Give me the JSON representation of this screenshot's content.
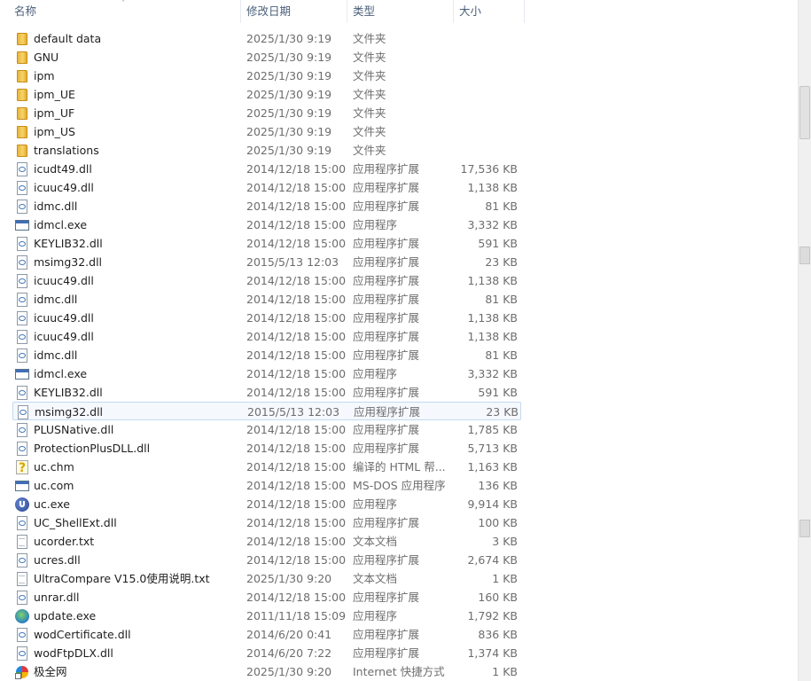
{
  "header": {
    "name": "名称",
    "date": "修改日期",
    "type": "类型",
    "size": "大小",
    "sort_arrow": "˄"
  },
  "files": [
    {
      "icon": "folder-icon",
      "name": "default data",
      "date": "2025/1/30 9:19",
      "type": "文件夹",
      "size": ""
    },
    {
      "icon": "folder-icon",
      "name": "GNU",
      "date": "2025/1/30 9:19",
      "type": "文件夹",
      "size": ""
    },
    {
      "icon": "folder-icon",
      "name": "ipm",
      "date": "2025/1/30 9:19",
      "type": "文件夹",
      "size": ""
    },
    {
      "icon": "folder-icon",
      "name": "ipm_UE",
      "date": "2025/1/30 9:19",
      "type": "文件夹",
      "size": ""
    },
    {
      "icon": "folder-icon",
      "name": "ipm_UF",
      "date": "2025/1/30 9:19",
      "type": "文件夹",
      "size": ""
    },
    {
      "icon": "folder-icon",
      "name": "ipm_US",
      "date": "2025/1/30 9:19",
      "type": "文件夹",
      "size": ""
    },
    {
      "icon": "folder-icon",
      "name": "translations",
      "date": "2025/1/30 9:19",
      "type": "文件夹",
      "size": ""
    },
    {
      "icon": "dll-file-icon",
      "name": "icudt49.dll",
      "date": "2014/12/18 15:00",
      "type": "应用程序扩展",
      "size": "17,536 KB"
    },
    {
      "icon": "dll-file-icon",
      "name": "icuuc49.dll",
      "date": "2014/12/18 15:00",
      "type": "应用程序扩展",
      "size": "1,138 KB"
    },
    {
      "icon": "dll-file-icon",
      "name": "idmc.dll",
      "date": "2014/12/18 15:00",
      "type": "应用程序扩展",
      "size": "81 KB"
    },
    {
      "icon": "exe-file-icon",
      "name": "idmcl.exe",
      "date": "2014/12/18 15:00",
      "type": "应用程序",
      "size": "3,332 KB"
    },
    {
      "icon": "dll-file-icon",
      "name": "KEYLIB32.dll",
      "date": "2014/12/18 15:00",
      "type": "应用程序扩展",
      "size": "591 KB"
    },
    {
      "icon": "dll-file-icon",
      "name": "msimg32.dll",
      "date": "2015/5/13 12:03",
      "type": "应用程序扩展",
      "size": "23 KB"
    },
    {
      "icon": "dll-file-icon",
      "name": "icuuc49.dll",
      "date": "2014/12/18 15:00",
      "type": "应用程序扩展",
      "size": "1,138 KB"
    },
    {
      "icon": "dll-file-icon",
      "name": "idmc.dll",
      "date": "2014/12/18 15:00",
      "type": "应用程序扩展",
      "size": "81 KB"
    },
    {
      "icon": "dll-file-icon",
      "name": "icuuc49.dll",
      "date": "2014/12/18 15:00",
      "type": "应用程序扩展",
      "size": "1,138 KB"
    },
    {
      "icon": "dll-file-icon",
      "name": "icuuc49.dll",
      "date": "2014/12/18 15:00",
      "type": "应用程序扩展",
      "size": "1,138 KB"
    },
    {
      "icon": "dll-file-icon",
      "name": "idmc.dll",
      "date": "2014/12/18 15:00",
      "type": "应用程序扩展",
      "size": "81 KB"
    },
    {
      "icon": "exe-file-icon",
      "name": "idmcl.exe",
      "date": "2014/12/18 15:00",
      "type": "应用程序",
      "size": "3,332 KB"
    },
    {
      "icon": "dll-file-icon",
      "name": "KEYLIB32.dll",
      "date": "2014/12/18 15:00",
      "type": "应用程序扩展",
      "size": "591 KB"
    },
    {
      "icon": "dll-file-icon",
      "name": "msimg32.dll",
      "date": "2015/5/13 12:03",
      "type": "应用程序扩展",
      "size": "23 KB",
      "selected": true
    },
    {
      "icon": "dll-file-icon",
      "name": "PLUSNative.dll",
      "date": "2014/12/18 15:00",
      "type": "应用程序扩展",
      "size": "1,785 KB"
    },
    {
      "icon": "dll-file-icon",
      "name": "ProtectionPlusDLL.dll",
      "date": "2014/12/18 15:00",
      "type": "应用程序扩展",
      "size": "5,713 KB"
    },
    {
      "icon": "help-file-icon",
      "name": "uc.chm",
      "date": "2014/12/18 15:00",
      "type": "编译的 HTML 帮...",
      "size": "1,163 KB"
    },
    {
      "icon": "exe-file-icon",
      "name": "uc.com",
      "date": "2014/12/18 15:00",
      "type": "MS-DOS 应用程序",
      "size": "136 KB"
    },
    {
      "icon": "uc-app-icon",
      "name": "uc.exe",
      "date": "2014/12/18 15:00",
      "type": "应用程序",
      "size": "9,914 KB"
    },
    {
      "icon": "dll-file-icon",
      "name": "UC_ShellExt.dll",
      "date": "2014/12/18 15:00",
      "type": "应用程序扩展",
      "size": "100 KB"
    },
    {
      "icon": "text-file-icon",
      "name": "ucorder.txt",
      "date": "2014/12/18 15:00",
      "type": "文本文档",
      "size": "3 KB"
    },
    {
      "icon": "dll-file-icon",
      "name": "ucres.dll",
      "date": "2014/12/18 15:00",
      "type": "应用程序扩展",
      "size": "2,674 KB"
    },
    {
      "icon": "text-file-icon",
      "name": "UltraCompare V15.0使用说明.txt",
      "date": "2025/1/30 9:20",
      "type": "文本文档",
      "size": "1 KB"
    },
    {
      "icon": "dll-file-icon",
      "name": "unrar.dll",
      "date": "2014/12/18 15:00",
      "type": "应用程序扩展",
      "size": "160 KB"
    },
    {
      "icon": "update-app-icon",
      "name": "update.exe",
      "date": "2011/11/18 15:09",
      "type": "应用程序",
      "size": "1,792 KB"
    },
    {
      "icon": "dll-file-icon",
      "name": "wodCertificate.dll",
      "date": "2014/6/20 0:41",
      "type": "应用程序扩展",
      "size": "836 KB"
    },
    {
      "icon": "dll-file-icon",
      "name": "wodFtpDLX.dll",
      "date": "2014/6/20 7:22",
      "type": "应用程序扩展",
      "size": "1,374 KB"
    },
    {
      "icon": "internet-shortcut-icon",
      "name": "极全网",
      "date": "2025/1/30 9:20",
      "type": "Internet 快捷方式",
      "size": "1 KB"
    }
  ]
}
